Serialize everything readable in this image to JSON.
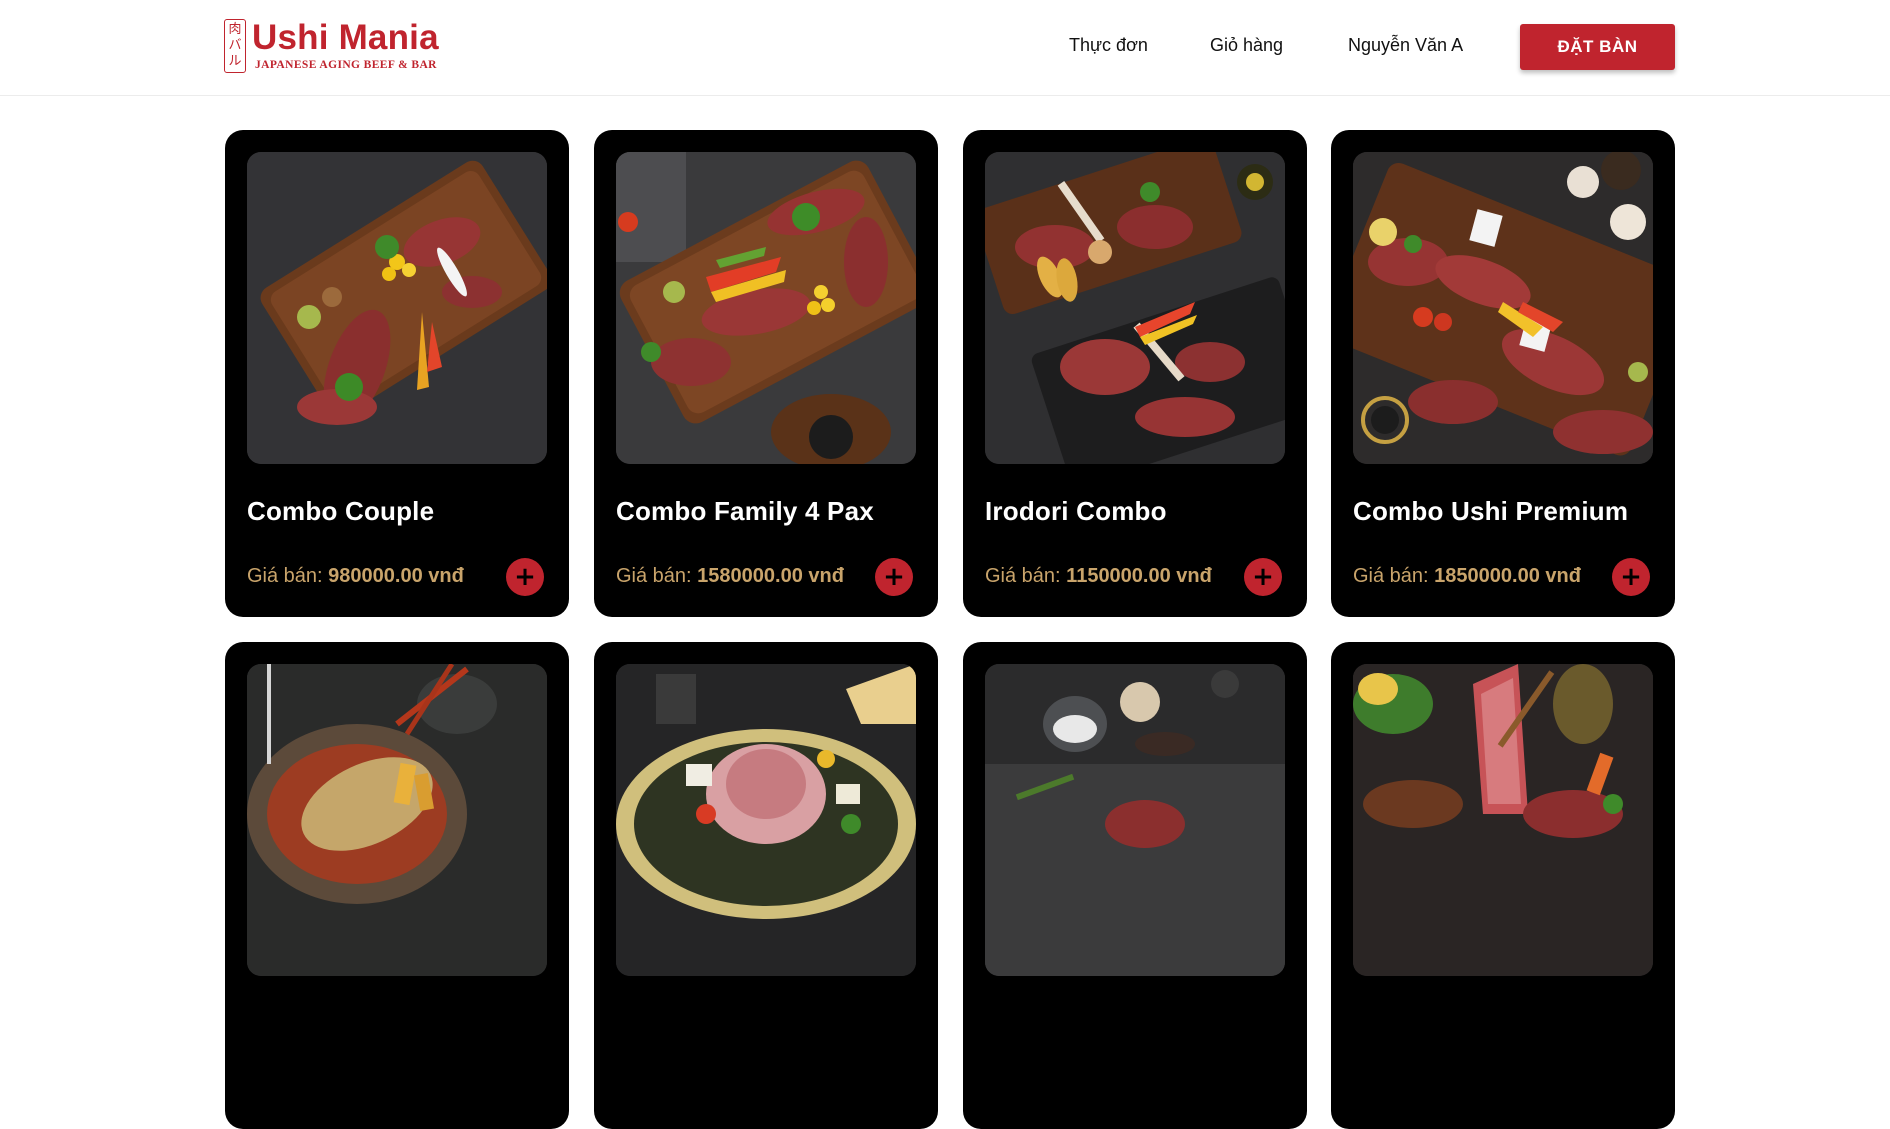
{
  "header": {
    "logo": {
      "seal": "肉バル",
      "title": "Ushi Mania",
      "subtitle": "JAPANESE AGING BEEF & BAR"
    },
    "nav": {
      "menu": "Thực đơn",
      "cart": "Giỏ hàng",
      "user": "Nguyễn Văn A",
      "book": "ĐẶT BÀN"
    }
  },
  "colors": {
    "brand": "#c0242e",
    "card": "#000000",
    "price": "#c9a46b"
  },
  "cards": [
    {
      "name": "Combo Couple",
      "price_label": "Giá bán:",
      "price": "980000.00 vnđ",
      "add": "+"
    },
    {
      "name": "Combo Family 4 Pax",
      "price_label": "Giá bán:",
      "price": "1580000.00 vnđ",
      "add": "+"
    },
    {
      "name": "Irodori Combo",
      "price_label": "Giá bán:",
      "price": "1150000.00 vnđ",
      "add": "+"
    },
    {
      "name": "Combo Ushi Premium",
      "price_label": "Giá bán:",
      "price": "1850000.00 vnđ",
      "add": "+"
    }
  ]
}
